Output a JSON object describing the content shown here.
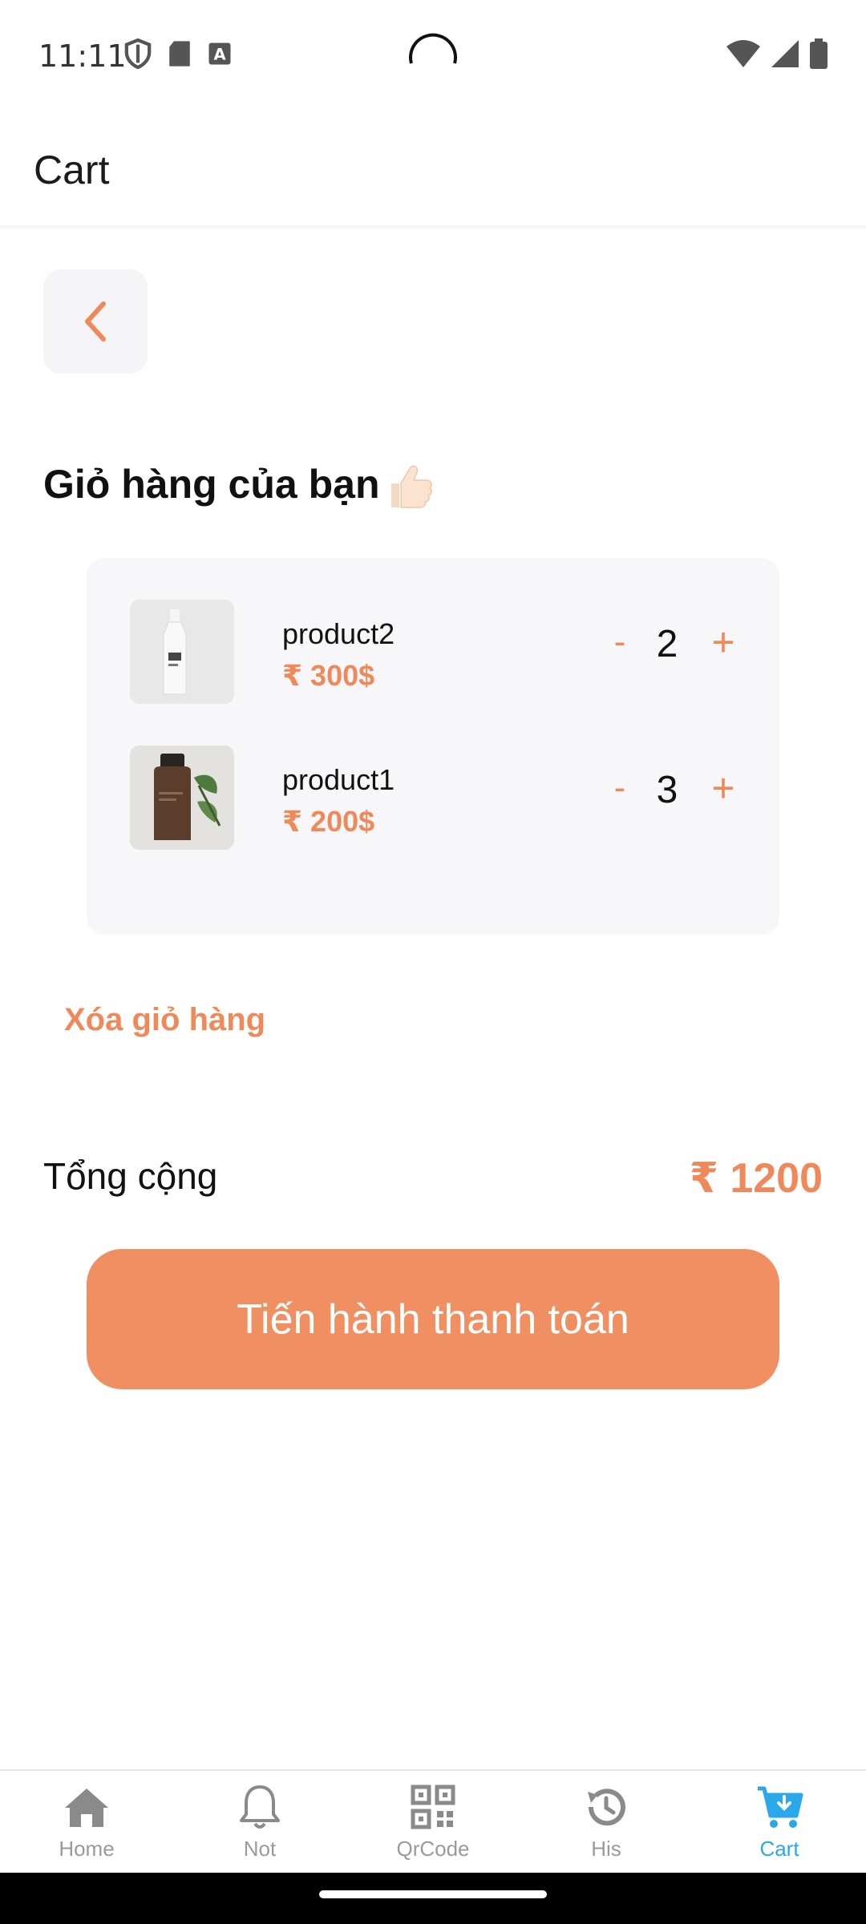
{
  "status_bar": {
    "time": "11:11"
  },
  "app_bar": {
    "title": "Cart"
  },
  "heading": "Giỏ hàng của bạn",
  "cart_items": [
    {
      "name": "product2",
      "price": "₹ 300$",
      "quantity": "2",
      "image": "white-bottle"
    },
    {
      "name": "product1",
      "price": "₹ 200$",
      "quantity": "3",
      "image": "amber-bottle"
    }
  ],
  "qty_minus_label": "-",
  "qty_plus_label": "+",
  "clear_cart_label": "Xóa giỏ hàng",
  "total": {
    "label": "Tổng cộng",
    "value": "₹ 1200"
  },
  "checkout_label": "Tiến hành thanh toán",
  "bottom_nav": [
    {
      "label": "Home",
      "icon": "home-icon",
      "active": false
    },
    {
      "label": "Not",
      "icon": "bell-icon",
      "active": false
    },
    {
      "label": "QrCode",
      "icon": "qrcode-icon",
      "active": false
    },
    {
      "label": "His",
      "icon": "history-icon",
      "active": false
    },
    {
      "label": "Cart",
      "icon": "cart-icon",
      "active": true
    }
  ],
  "colors": {
    "accent": "#f0895a",
    "button": "#f08f61",
    "active_nav": "#2aa8ea",
    "card_bg": "#f7f7f9"
  }
}
